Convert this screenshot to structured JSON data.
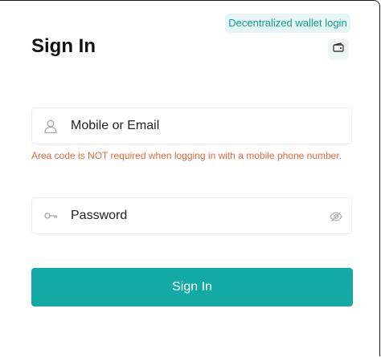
{
  "header": {
    "wallet_login_label": "Decentralized wallet login",
    "title": "Sign In",
    "wallet_icon": "wallet-icon"
  },
  "account_field": {
    "placeholder": "Mobile or Email",
    "value": "",
    "icon": "user-icon",
    "hint": "Area code is NOT required when logging in with a mobile phone number."
  },
  "password_field": {
    "placeholder": "Password",
    "value": "",
    "icon": "key-icon",
    "toggle_icon": "eye-slash-icon"
  },
  "submit": {
    "label": "Sign In"
  },
  "colors": {
    "accent": "#13a9a5",
    "badge_bg": "#e6f6f5",
    "badge_text": "#139c97",
    "hint_text": "#e06a3c"
  }
}
